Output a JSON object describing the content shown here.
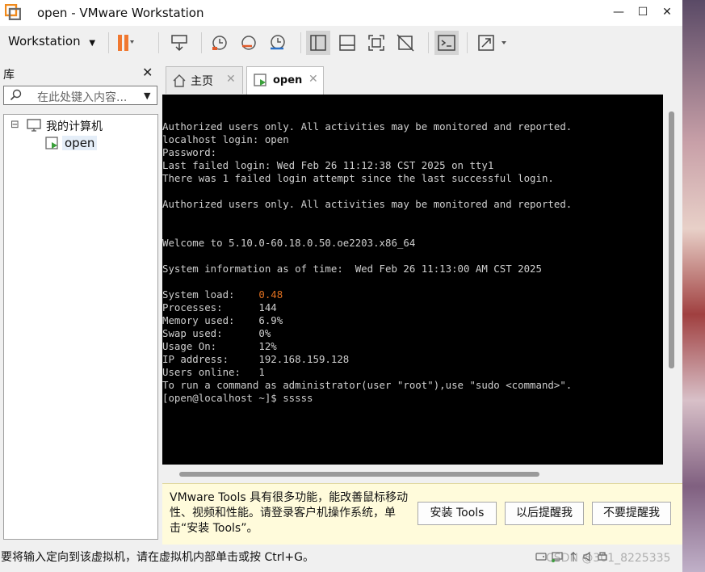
{
  "window": {
    "title": "open - VMware Workstation",
    "min_glyph": "—",
    "max_glyph": "☐",
    "close_glyph": "✕"
  },
  "toolbar": {
    "menu_label": "Workstation",
    "menu_arrow": "▼"
  },
  "library": {
    "title": "库",
    "close": "✕",
    "search_placeholder": "在此处键入内容...",
    "tree": {
      "root_toggle": "⊟",
      "root_label": "我的计算机",
      "child_label": "open"
    }
  },
  "tabs": [
    {
      "label": "主页",
      "active": false,
      "close": "✕"
    },
    {
      "label": "open",
      "active": true,
      "close": "✕"
    }
  ],
  "terminal": {
    "lines": [
      "Authorized users only. All activities may be monitored and reported.",
      "localhost login: open",
      "Password:",
      "Last failed login: Wed Feb 26 11:12:38 CST 2025 on tty1",
      "There was 1 failed login attempt since the last successful login.",
      "",
      "Authorized users only. All activities may be monitored and reported.",
      "",
      "",
      "Welcome to 5.10.0-60.18.0.50.oe2203.x86_64",
      "",
      "System information as of time:  Wed Feb 26 11:13:00 AM CST 2025",
      "",
      "System load:    ",
      "Processes:      144",
      "Memory used:    6.9%",
      "Swap used:      0%",
      "Usage On:       12%",
      "IP address:     192.168.159.128",
      "Users online:   1",
      "To run a command as administrator(user \"root\"),use \"sudo <command>\".",
      "[open@localhost ~]$ sssss"
    ],
    "system_load_value": "0.48",
    "highlight_color": "#e07020"
  },
  "tools_notice": {
    "message": "VMware Tools 具有很多功能，能改善鼠标移动性、视频和性能。请登录客户机操作系统，单击“安装 Tools”。",
    "install_button": "安装 Tools",
    "later_button": "以后提醒我",
    "never_button": "不要提醒我"
  },
  "status_bar": {
    "text": "要将输入定向到该虚拟机，请在虚拟机内部单击或按 Ctrl+G。",
    "watermark": "CSDN @301_8225335"
  },
  "colors": {
    "pause_orange": "#f07830",
    "play_green": "#3aa03a",
    "tools_bg": "#fffbdb"
  }
}
